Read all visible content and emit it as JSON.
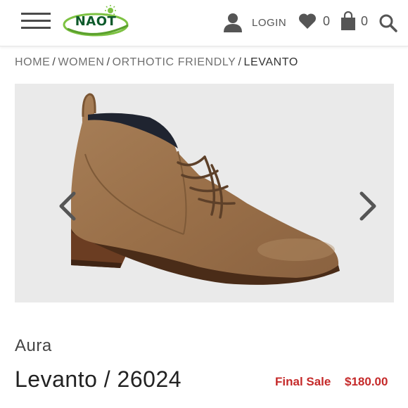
{
  "header": {
    "logo_text": "NAOT",
    "login_label": "LOGIN",
    "wishlist_count": "0",
    "cart_count": "0"
  },
  "breadcrumb": {
    "items": [
      "HOME",
      "WOMEN",
      "ORTHOTIC FRIENDLY"
    ],
    "current": "LEVANTO",
    "separator": "/"
  },
  "product": {
    "collection": "Aura",
    "name": "Levanto / 26024",
    "sale_label": "Final Sale",
    "price": "$180.00"
  },
  "colors": {
    "sale_red": "#c52a2a",
    "logo_green": "#0e5a2b",
    "logo_light_green": "#7dc242",
    "gallery_bg": "#eaeaea"
  },
  "icons": {
    "menu": "hamburger-icon",
    "user": "user-icon",
    "wishlist": "heart-icon",
    "cart": "shopping-bag-icon",
    "search": "search-icon",
    "prev": "chevron-left-icon",
    "next": "chevron-right-icon"
  }
}
